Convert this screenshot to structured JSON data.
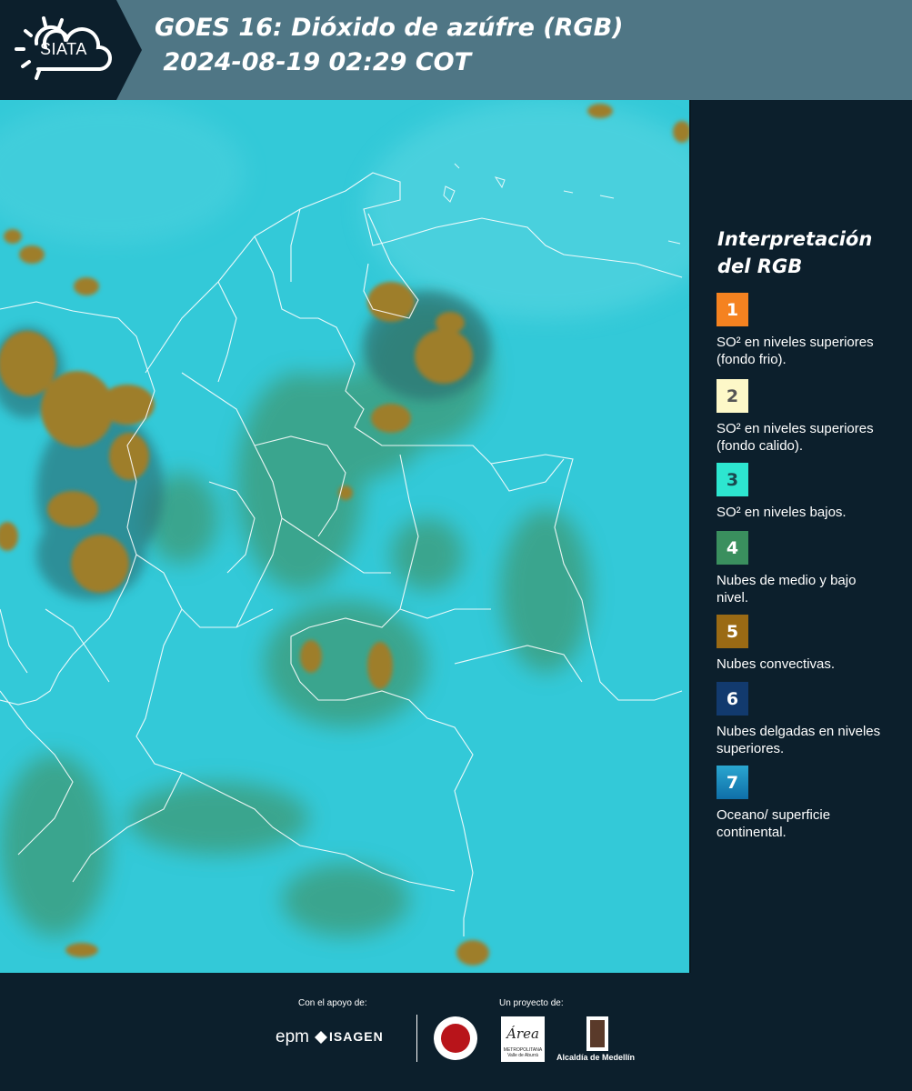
{
  "header": {
    "logo_text": "SIATA",
    "title_line1": "GOES 16: Dióxido de azúfre (RGB)",
    "title_line2": " 2024-08-19 02:29 COT",
    "bg_color": "#4f7685"
  },
  "legend": {
    "title": "Interpretación del RGB",
    "items": [
      {
        "number": "1",
        "label": "SO² en niveles superiores (fondo frio).",
        "color": "#f58220",
        "num_color": "#ffffff"
      },
      {
        "number": "2",
        "label": "SO² en niveles superiores (fondo calido).",
        "color": "#fdf8c8",
        "num_color": "#555555"
      },
      {
        "number": "3",
        "label": "SO² en niveles bajos.",
        "color": "#2de6d0",
        "num_color": "#1a4a50"
      },
      {
        "number": "4",
        "label": "Nubes de medio y bajo nivel.",
        "color": "#3a8f5e",
        "num_color": "#ffffff"
      },
      {
        "number": "5",
        "label": "Nubes convectivas.",
        "color": "#9a6a14",
        "num_color": "#ffffff"
      },
      {
        "number": "6",
        "label": "Nubes delgadas en niveles superiores.",
        "color": "#123a6e",
        "num_color": "#ffffff"
      },
      {
        "number": "7",
        "label": "Oceano/ superficie continental.",
        "color": "#1a8fc6",
        "num_color": "#ffffff"
      }
    ]
  },
  "map": {
    "ocean_color": "#2ec6d6",
    "convective_color": "#a0802e",
    "low_cloud_color": "#3e9a74"
  },
  "footer": {
    "support_label": "Con el apoyo de:",
    "project_label": "Un proyecto de:",
    "epm": "epm",
    "isagen": "ISAGEN",
    "area_text": "Área",
    "area_sub": "METROPOLITANA Valle de Aburrá",
    "alcaldia": "Alcaldía de Medellín"
  }
}
